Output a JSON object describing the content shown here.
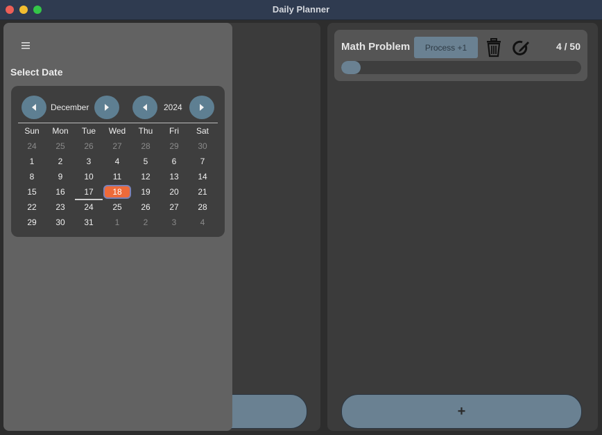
{
  "window": {
    "title": "Daily Planner"
  },
  "drawer": {
    "select_date_label": "Select Date"
  },
  "calendar": {
    "month": "December",
    "year": "2024",
    "weekdays": [
      "Sun",
      "Mon",
      "Tue",
      "Wed",
      "Thu",
      "Fri",
      "Sat"
    ],
    "weeks": [
      [
        "24",
        "25",
        "26",
        "27",
        "28",
        "29",
        "30"
      ],
      [
        "1",
        "2",
        "3",
        "4",
        "5",
        "6",
        "7"
      ],
      [
        "8",
        "9",
        "10",
        "11",
        "12",
        "13",
        "14"
      ],
      [
        "15",
        "16",
        "17",
        "18",
        "19",
        "20",
        "21"
      ],
      [
        "22",
        "23",
        "24",
        "25",
        "26",
        "27",
        "28"
      ],
      [
        "29",
        "30",
        "31",
        "1",
        "2",
        "3",
        "4"
      ]
    ],
    "selected_day": "18",
    "today_day": "17",
    "selected_color": "#ee6a3a"
  },
  "task": {
    "name": "Math Problem",
    "process_label": "Process +1",
    "count_label": "4 / 50",
    "progress": 0.08
  },
  "add_button": {
    "label": "+"
  },
  "colors": {
    "accent": "#6a8192",
    "nav_button": "#5e7f92"
  }
}
